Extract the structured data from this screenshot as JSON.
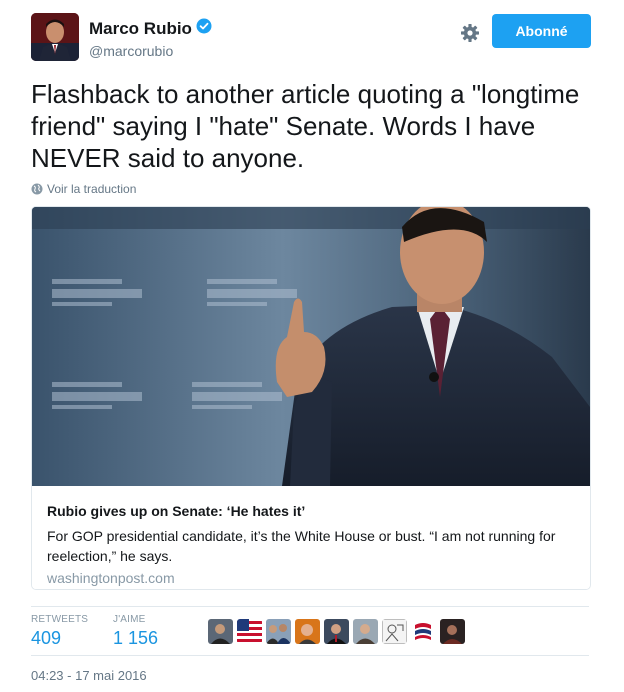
{
  "header": {
    "display_name": "Marco Rubio",
    "handle": "@marcorubio",
    "follow_label": "Abonné",
    "verified": true
  },
  "tweet": {
    "text": "Flashback to another article quoting a \"longtime friend\" saying I \"hate\" Senate. Words I have NEVER said to anyone.",
    "translate_label": "Voir la traduction"
  },
  "card": {
    "title": "Rubio gives up on Senate: ‘He hates it’",
    "description": "For GOP presidential candidate, it’s the White House or bust. “I am not running for reelection,” he says.",
    "domain": "washingtonpost.com"
  },
  "stats": {
    "retweets_label": "RETWEETS",
    "retweets_value": "409",
    "likes_label": "J'AIME",
    "likes_value": "1 156"
  },
  "likers": [
    {
      "icon": "liker-avatar"
    },
    {
      "icon": "us-flag-avatar"
    },
    {
      "icon": "group-avatar"
    },
    {
      "icon": "liker-avatar"
    },
    {
      "icon": "liker-avatar"
    },
    {
      "icon": "liker-avatar"
    },
    {
      "icon": "sketch-avatar"
    },
    {
      "icon": "flag-logo-avatar"
    },
    {
      "icon": "liker-avatar"
    }
  ],
  "timestamp": "04:23 - 17 mai 2016",
  "colors": {
    "accent": "#1da1f2",
    "link": "#1b95e0",
    "muted": "#657786",
    "border": "#e1e8ed"
  }
}
